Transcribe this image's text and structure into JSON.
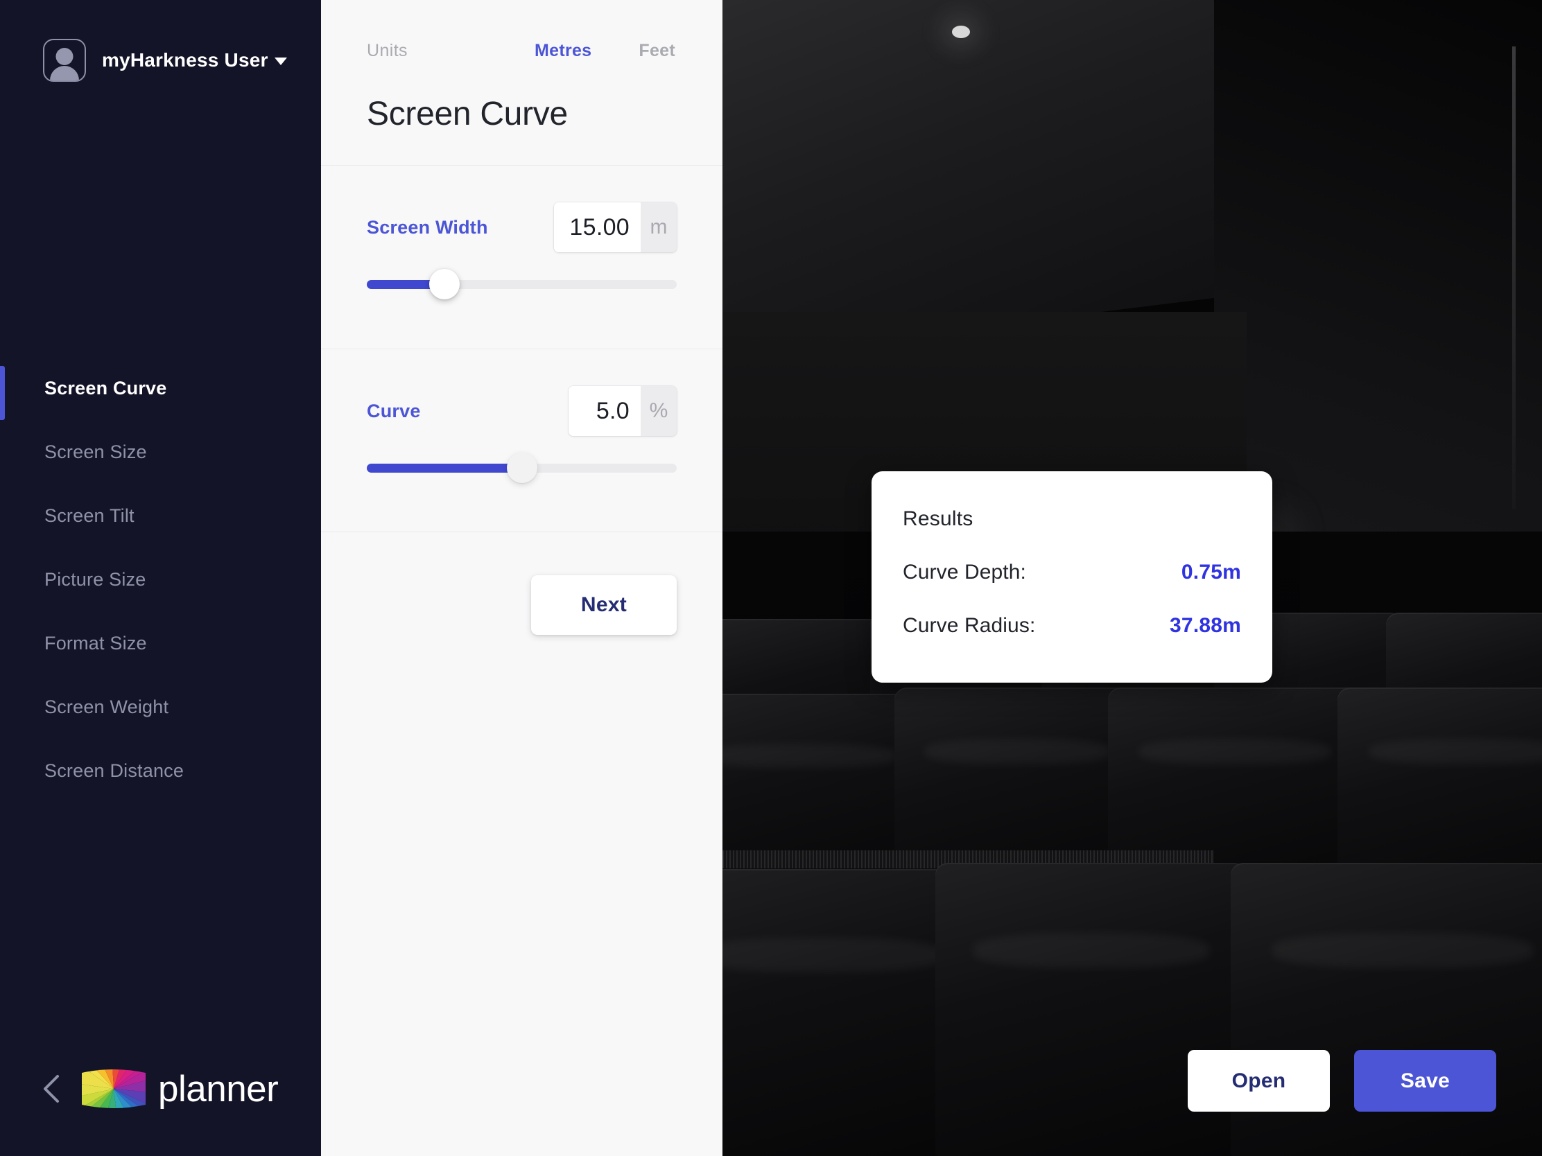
{
  "sidebar": {
    "user": {
      "name": "myHarkness User",
      "avatar_icon": "user-avatar-icon",
      "caret_icon": "caret-down-icon"
    },
    "items": [
      {
        "label": "Screen Curve",
        "active": true
      },
      {
        "label": "Screen Size",
        "active": false
      },
      {
        "label": "Screen Tilt",
        "active": false
      },
      {
        "label": "Picture Size",
        "active": false
      },
      {
        "label": "Format Size",
        "active": false
      },
      {
        "label": "Screen Weight",
        "active": false
      },
      {
        "label": "Screen Distance",
        "active": false
      }
    ],
    "brand": {
      "text": "planner",
      "back_icon": "chevron-left-icon",
      "logo_icon": "rainbow-curved-screen-logo"
    },
    "active_color": "#4c55d6",
    "background": "#141428"
  },
  "panel": {
    "units_label": "Units",
    "units": [
      {
        "label": "Metres",
        "selected": true
      },
      {
        "label": "Feet",
        "selected": false
      }
    ],
    "title": "Screen Curve",
    "fields": [
      {
        "label": "Screen Width",
        "value": "15.00",
        "suffix": "m",
        "slider_percent": 25
      },
      {
        "label": "Curve",
        "value": "5.0",
        "suffix": "%",
        "slider_percent": 50
      }
    ],
    "next_label": "Next",
    "accent_color": "#4c55d6",
    "background": "#f8f8f9"
  },
  "viewport": {
    "results": {
      "title": "Results",
      "rows": [
        {
          "label": "Curve Depth:",
          "value": "0.75m"
        },
        {
          "label": "Curve Radius:",
          "value": "37.88m"
        }
      ],
      "value_color": "#2f33e0"
    },
    "actions": [
      {
        "label": "Open",
        "style": "light"
      },
      {
        "label": "Save",
        "style": "primary"
      }
    ]
  }
}
